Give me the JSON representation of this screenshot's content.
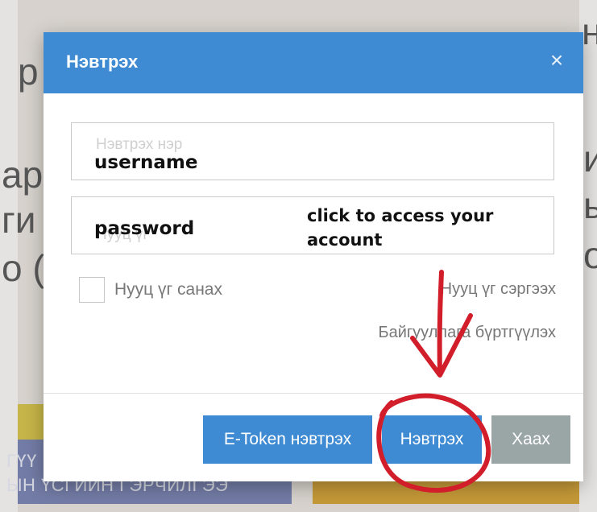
{
  "background": {
    "left_letters": [
      "p",
      "ap",
      "ги",
      "о ("
    ],
    "right_letters": [
      "н",
      "и",
      "ы",
      "о"
    ],
    "tile_lines": [
      "ГҮҮ",
      "ЫН ҮСГИЙН ГЭРЧИЛГЭЭ"
    ]
  },
  "modal": {
    "title": "Нэвтрэх",
    "close_glyph": "×",
    "username": {
      "placeholder": "Нэвтрэх нэр",
      "annotation": "username"
    },
    "password": {
      "placeholder": "Нууц үг",
      "annotation": "password",
      "note": "click to access your account"
    },
    "remember_label": "Нууц үг санах",
    "forgot_link": "Нууц үг сэргээх",
    "register_link": "Байгууллага бүртгүүлэх",
    "buttons": {
      "etoken": "E-Token нэвтрэх",
      "login": "Нэвтрэх",
      "close": "Хаах"
    }
  },
  "colors": {
    "header": "#3f8bd3",
    "primary_button": "#3f8bd3",
    "close_button": "#9aa5a6",
    "annotation": "#d21d2a"
  },
  "icons": [
    "close-icon",
    "checkbox-icon",
    "arrow-annotation-icon",
    "circle-annotation-icon"
  ]
}
